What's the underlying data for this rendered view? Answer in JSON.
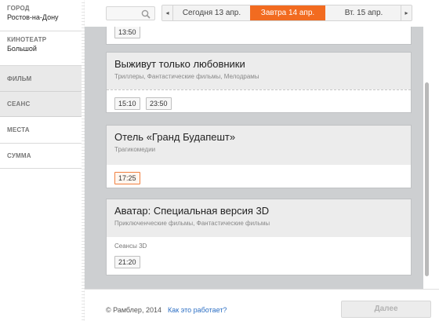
{
  "sidebar": {
    "city": {
      "label": "ГОРОД",
      "value": "Ростов-на-Дону"
    },
    "cinema": {
      "label": "КИНОТЕАТР",
      "value": "Большой"
    },
    "film": {
      "label": "ФИЛЬМ"
    },
    "seance": {
      "label": "СЕАНС"
    },
    "places": {
      "label": "МЕСТА"
    },
    "sum": {
      "label": "СУММА"
    }
  },
  "search": {
    "value": "",
    "placeholder": "",
    "icon": "search-icon"
  },
  "dates": {
    "prev_icon": "◂",
    "next_icon": "▸",
    "tabs": [
      {
        "label": "Сегодня 13 апр."
      },
      {
        "label": "Завтра 14 апр."
      },
      {
        "label": "Вт. 15 апр."
      }
    ],
    "active_color": "#f26b20"
  },
  "films": [
    {
      "title": "",
      "genres": "",
      "times": [
        "13:50"
      ]
    },
    {
      "title": "Выживут только любовники",
      "genres": "Триллеры, Фантастические фильмы, Мелодрамы",
      "times": [
        "15:10",
        "23:50"
      ]
    },
    {
      "title": "Отель «Гранд Будапешт»",
      "genres": "Трагикомедии",
      "times": [
        "17:25"
      ]
    },
    {
      "title": "Аватар: Специальная версия 3D",
      "genres": "Приключенческие фильмы, Фантастические фильмы",
      "sublabel": "Сеансы 3D",
      "times": [
        "21:20"
      ]
    }
  ],
  "footer": {
    "copyright": "© Рамблер, 2014",
    "how_link": "Как это работает?",
    "next_label": "Далее"
  }
}
